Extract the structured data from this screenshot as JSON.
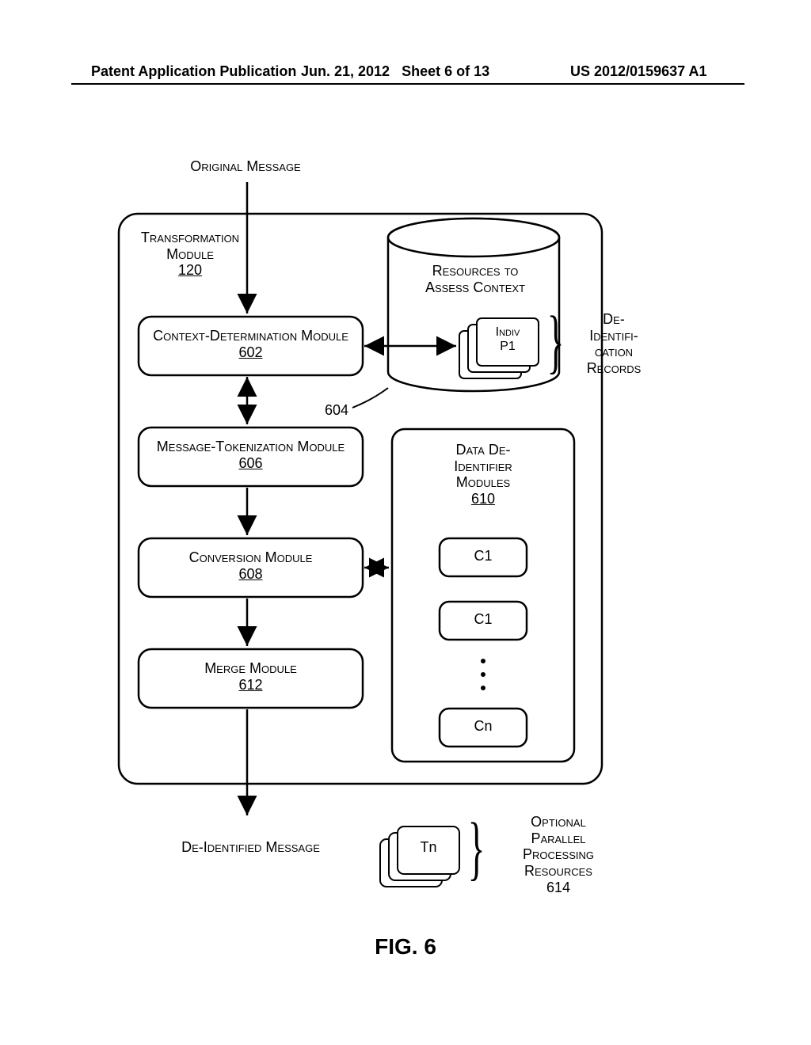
{
  "header": {
    "left": "Patent Application Publication",
    "mid_date": "Jun. 21, 2012",
    "mid_sheet": "Sheet 6 of 13",
    "right": "US 2012/0159637 A1"
  },
  "top_label": "Original Message",
  "outer": {
    "title_line1": "Transformation",
    "title_line2": "Module",
    "ref": "120"
  },
  "cylinder": {
    "title_line1": "Resources to",
    "title_line2": "Assess Context",
    "card_line1": "Indiv",
    "card_line2": "P1",
    "side_label_l1": "De-",
    "side_label_l2": "Identifi-",
    "side_label_l3": "cation",
    "side_label_l4": "Records"
  },
  "left_num_604": "604",
  "modules": {
    "cdm_line1": "Context-Determination Module",
    "cdm_ref": "602",
    "mtm_line1": "Message-Tokenization Module",
    "mtm_ref": "606",
    "conv_line1": "Conversion Module",
    "conv_ref": "608",
    "merge_line1": "Merge Module",
    "merge_ref": "612"
  },
  "right_box": {
    "line1": "Data De-",
    "line2": "Identifier",
    "line3": "Modules",
    "ref": "610",
    "c1a": "C1",
    "c1b": "C1",
    "cn": "Cn"
  },
  "bottom": {
    "deid_msg": "De-Identified Message",
    "tn": "Tn",
    "opt_line1": "Optional",
    "opt_line2": "Parallel",
    "opt_line3": "Processing",
    "opt_line4": "Resources",
    "opt_ref": "614"
  },
  "figure_caption": "FIG. 6"
}
